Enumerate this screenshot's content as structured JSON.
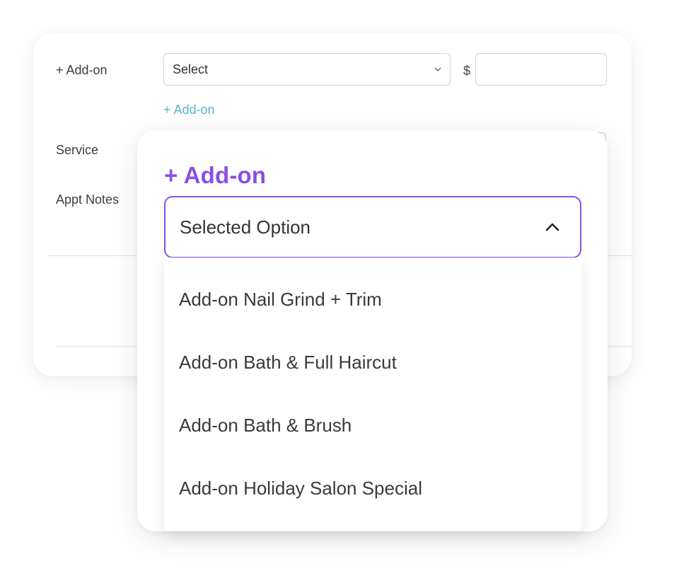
{
  "form": {
    "addon_label": "+ Add-on",
    "addon_select_value": "Select",
    "currency_symbol": "$",
    "price_value": "",
    "add_addon_link": "+ Add-on",
    "service_label": "Service",
    "appt_notes_label": "Appt Notes"
  },
  "popover": {
    "title": "+ Add-on",
    "selected_value": "Selected Option",
    "options": [
      "Add-on Nail Grind + Trim",
      "Add-on Bath & Full Haircut",
      "Add-on Bath & Brush",
      "Add-on Holiday Salon Special"
    ]
  },
  "colors": {
    "accent_purple": "#8a4fe6",
    "link_teal": "#57b7c9"
  },
  "icons": {
    "select_chevron": "chevron-down-icon",
    "open_chevron": "chevron-up-icon"
  }
}
